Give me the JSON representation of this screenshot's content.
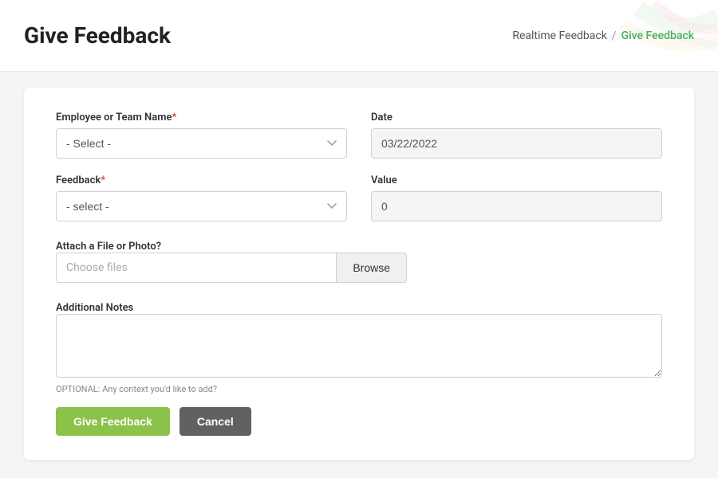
{
  "header": {
    "title": "Give Feedback",
    "breadcrumb": {
      "parent": "Realtime Feedback",
      "separator": "/",
      "current": "Give Feedback"
    }
  },
  "form": {
    "employee_label": "Employee or Team Name",
    "employee_required": "*",
    "employee_placeholder": "- Select -",
    "date_label": "Date",
    "date_value": "03/22/2022",
    "feedback_label": "Feedback",
    "feedback_required": "*",
    "feedback_placeholder": "- select -",
    "value_label": "Value",
    "value_value": "0",
    "attach_label": "Attach a File or Photo?",
    "file_placeholder": "Choose files",
    "browse_label": "Browse",
    "notes_label": "Additional Notes",
    "notes_hint": "OPTIONAL: Any context you'd like to add?",
    "submit_label": "Give Feedback",
    "cancel_label": "Cancel"
  }
}
